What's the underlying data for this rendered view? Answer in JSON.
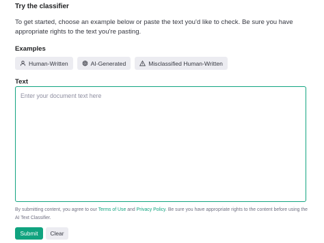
{
  "heading": "Try the classifier",
  "intro": "To get started, choose an example below or paste the text you'd like to check. Be sure you have appropriate rights to the text you're pasting.",
  "examples": {
    "label": "Examples",
    "items": [
      {
        "label": "Human-Written",
        "icon": "person-icon"
      },
      {
        "label": "AI-Generated",
        "icon": "openai-logo-icon"
      },
      {
        "label": "Misclassified Human-Written",
        "icon": "warning-icon"
      }
    ]
  },
  "text_section": {
    "label": "Text",
    "placeholder": "Enter your document text here",
    "value": ""
  },
  "disclaimer": {
    "before": "By submitting content, you agree to our ",
    "terms_link": "Terms of Use",
    "and": " and ",
    "privacy_link": "Privacy Policy",
    "after": ". Be sure you have appropriate rights to the content before using the AI Text Classifier."
  },
  "buttons": {
    "submit": "Submit",
    "clear": "Clear"
  },
  "colors": {
    "accent": "#10a37f",
    "chip_bg": "#ececf1"
  }
}
